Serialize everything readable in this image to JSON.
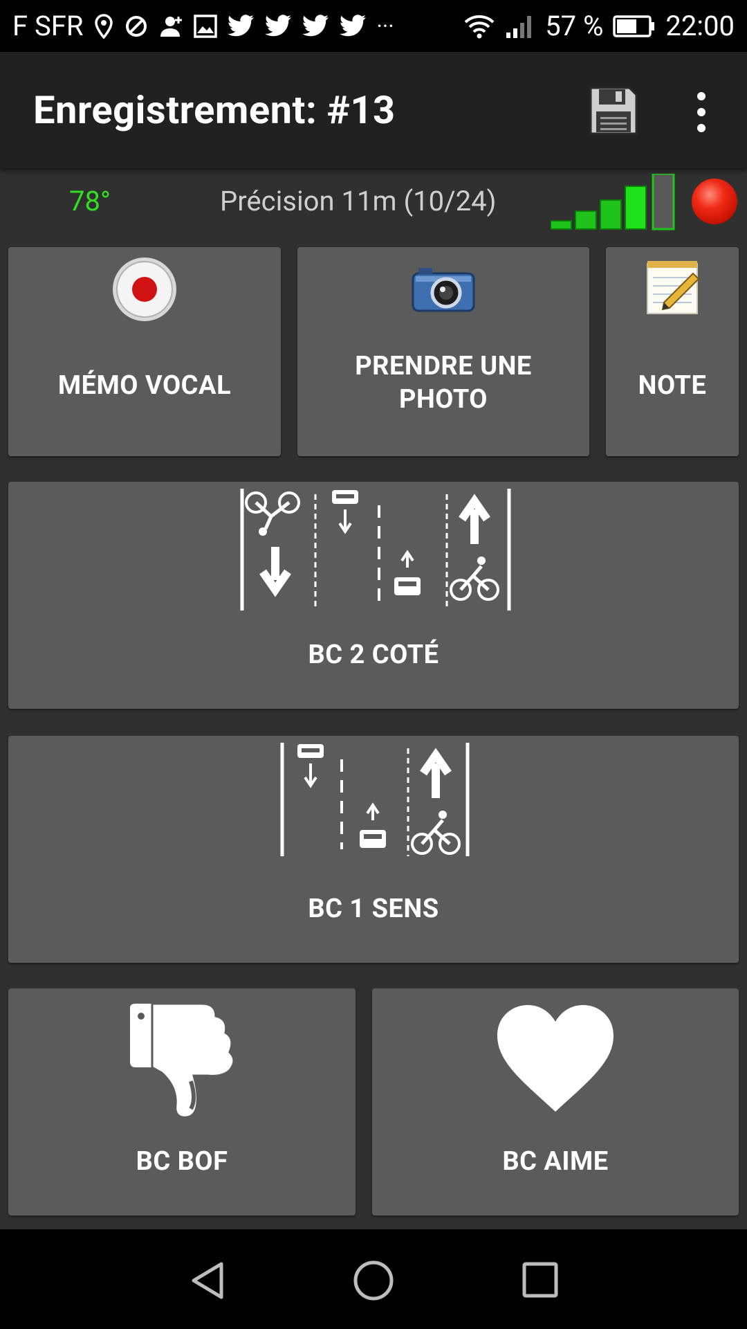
{
  "status_bar": {
    "carrier": "F SFR",
    "battery": "57 %",
    "time": "22:00",
    "icons": [
      "location-icon",
      "app-icon",
      "contact-add-icon",
      "gallery-icon",
      "twitter-icon",
      "twitter-icon",
      "twitter-icon",
      "twitter-icon",
      "more-notifications-icon",
      "wifi-icon",
      "cell-signal-icon",
      "battery-icon"
    ],
    "more": "···"
  },
  "app_bar": {
    "title": "Enregistrement: #13",
    "save_icon": "save-icon",
    "overflow_icon": "more-vert-icon"
  },
  "gps": {
    "angle": "78°",
    "precision": "Précision 11m (10/24)",
    "signal_levels": 5,
    "recording_indicator": "red"
  },
  "buttons": {
    "memo": {
      "label": "MÉMO VOCAL",
      "icon": "record-icon"
    },
    "photo": {
      "label_line1": "PRENDRE UNE",
      "label_line2": "PHOTO",
      "icon": "camera-icon"
    },
    "note": {
      "label": "NOTE",
      "icon": "notepad-icon"
    },
    "bc2": {
      "label": "BC 2 COTÉ",
      "icon": "bike-lane-two-way-icon"
    },
    "bc1": {
      "label": "BC 1 SENS",
      "icon": "bike-lane-one-way-icon"
    },
    "bof": {
      "label": "BC BOF",
      "icon": "thumbs-down-icon"
    },
    "aime": {
      "label": "BC AIME",
      "icon": "heart-icon"
    }
  },
  "nav_bar": {
    "icons": [
      "back-icon",
      "home-icon",
      "recents-icon"
    ]
  },
  "colors": {
    "accent_green": "#33dd22",
    "button_bg": "#5b5b5c",
    "app_bg": "#303030",
    "record_red": "#e8200f"
  }
}
